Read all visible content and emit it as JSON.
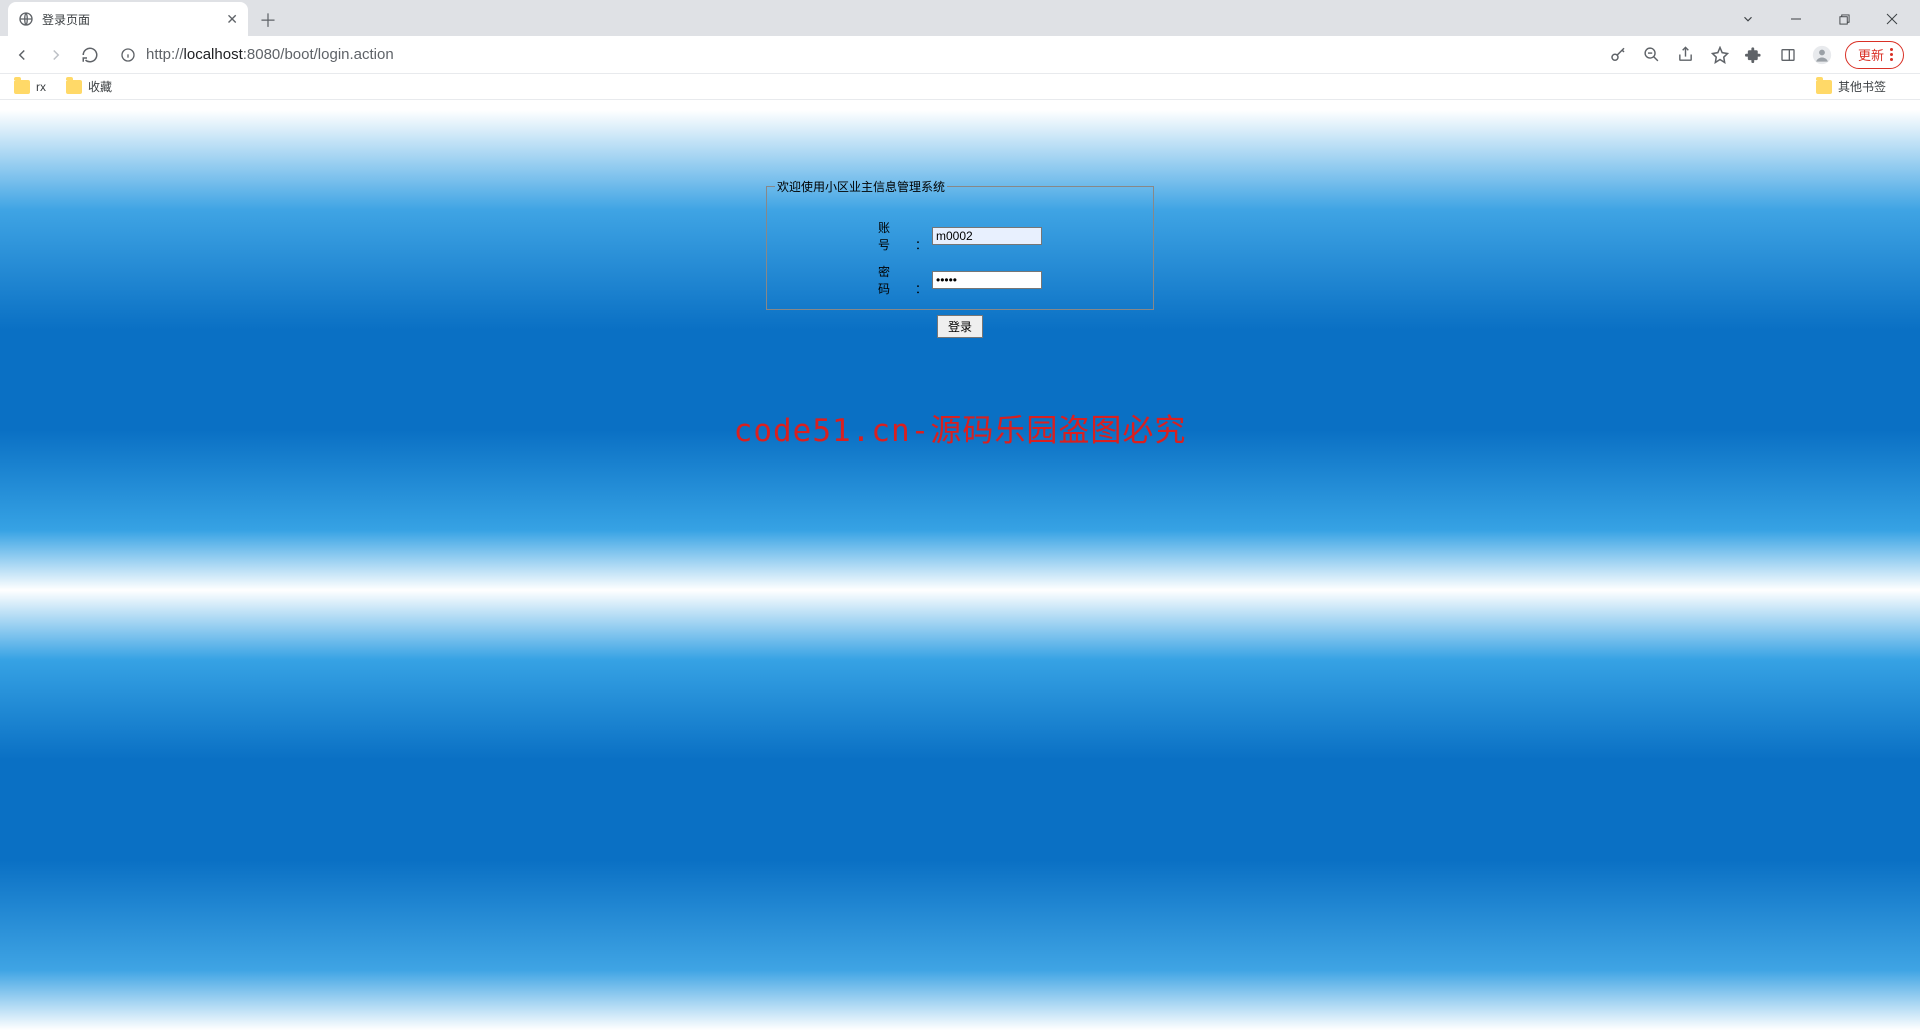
{
  "browser": {
    "tab_title": "登录页面",
    "url_prefix": "http://",
    "url_host": "localhost",
    "url_port": ":8080",
    "url_path": "/boot/login.action",
    "update_label": "更新",
    "bookmarks": {
      "rx": "rx",
      "fav": "收藏",
      "other": "其他书签"
    }
  },
  "login": {
    "legend": "欢迎使用小区业主信息管理系统",
    "account_label": "账　号：",
    "account_value": "m0002",
    "password_label": "密　码：",
    "password_value": "•••••",
    "submit_label": "登录"
  },
  "watermark": "code51.cn-源码乐园盗图必究"
}
